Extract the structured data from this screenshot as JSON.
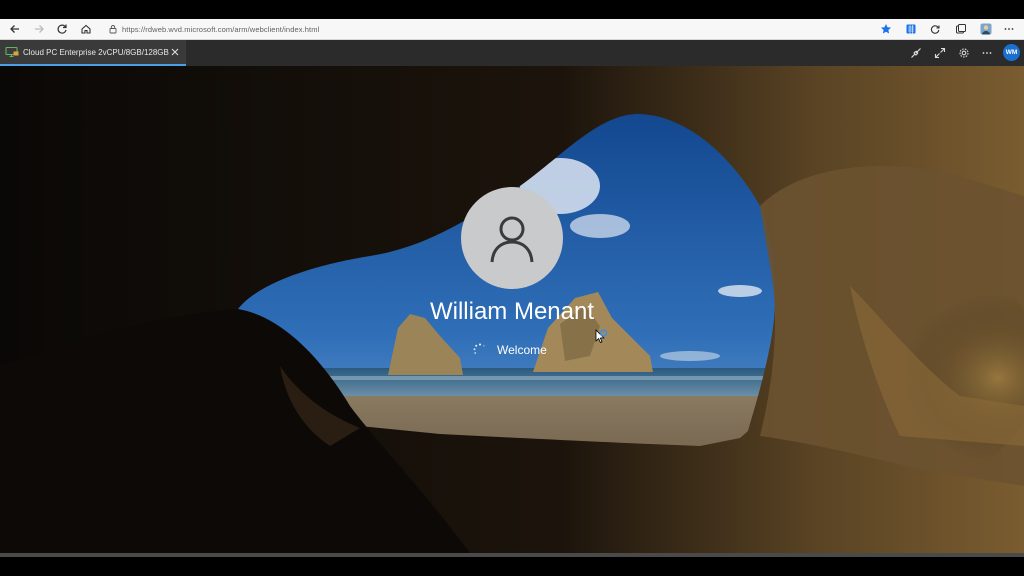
{
  "browser": {
    "url": "https://rdweb.wvd.microsoft.com/arm/webclient/index.html",
    "icons": [
      "back-icon",
      "forward-icon",
      "refresh-icon",
      "home-icon",
      "lock-icon",
      "favorite-star-icon",
      "collections-icon",
      "extension-icon",
      "tab-actions-icon",
      "profile-icon",
      "more-icon"
    ]
  },
  "rd_client": {
    "tab_label": "Cloud PC Enterprise 2vCPU/8GB/128GB",
    "user_initials": "WM",
    "accent_color": "#4aa0e6",
    "controls": [
      "disconnect-icon",
      "fullscreen-icon",
      "settings-icon",
      "more-icon"
    ]
  },
  "lock_screen": {
    "user_name": "William Menant",
    "status": "Welcome"
  }
}
